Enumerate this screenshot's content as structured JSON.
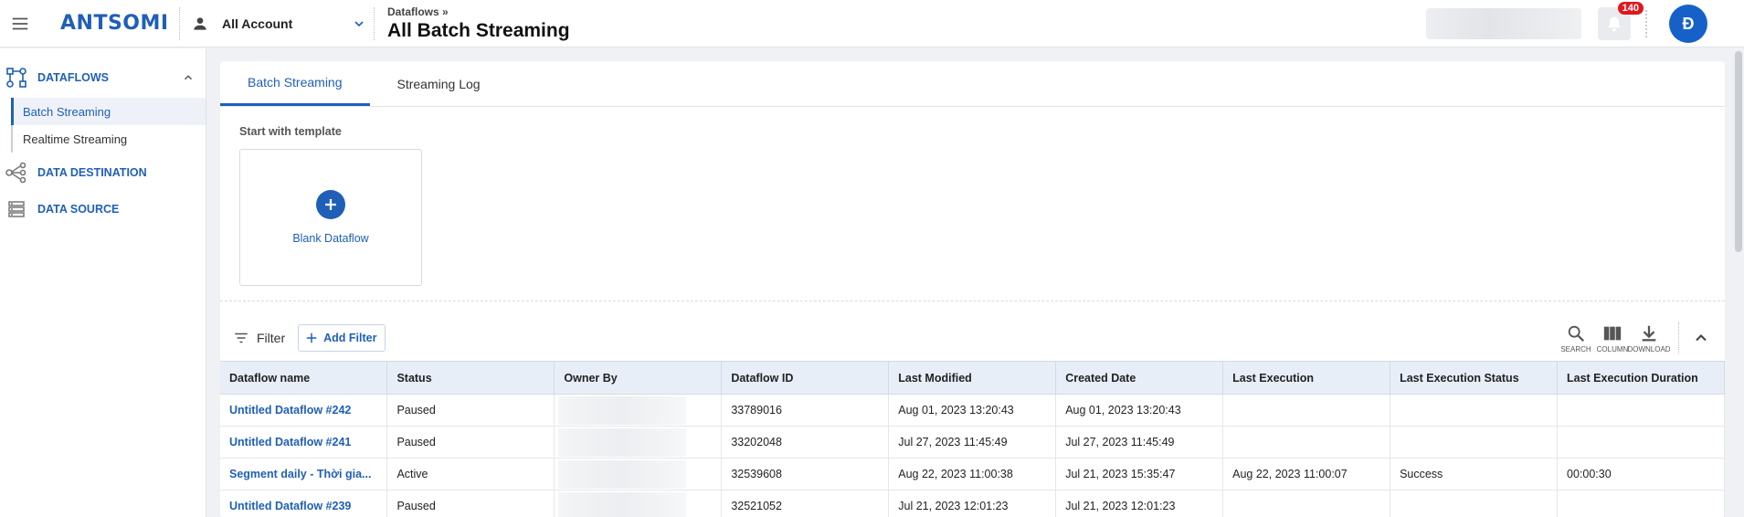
{
  "header": {
    "logo": "ANTSOMI",
    "account_label": "All Account",
    "breadcrumb": "Dataflows »",
    "title": "All Batch Streaming",
    "notification_count": "140",
    "avatar_letter": "Đ"
  },
  "sidebar": {
    "groups": [
      {
        "label": "DATAFLOWS",
        "icon": "dataflow-icon"
      },
      {
        "label": "DATA DESTINATION",
        "icon": "share-nodes-icon"
      },
      {
        "label": "DATA SOURCE",
        "icon": "server-list-icon"
      }
    ],
    "dataflow_items": [
      "Batch Streaming",
      "Realtime Streaming"
    ]
  },
  "tabs": [
    "Batch Streaming",
    "Streaming Log"
  ],
  "template": {
    "title": "Start with template",
    "card_label": "Blank Dataflow"
  },
  "filter": {
    "label": "Filter",
    "add_label": "Add Filter"
  },
  "tools": {
    "search": "SEARCH",
    "column": "COLUMN",
    "download": "DOWNLOAD"
  },
  "table": {
    "headers": [
      "Dataflow name",
      "Status",
      "Owner By",
      "Dataflow ID",
      "Last Modified",
      "Created Date",
      "Last Execution",
      "Last Execution Status",
      "Last Execution Duration"
    ],
    "rows": [
      [
        "Untitled Dataflow #242",
        "Paused",
        "",
        "33789016",
        "Aug 01, 2023 13:20:43",
        "Aug 01, 2023 13:20:43",
        "",
        "",
        ""
      ],
      [
        "Untitled Dataflow #241",
        "Paused",
        "",
        "33202048",
        "Jul 27, 2023 11:45:49",
        "Jul 27, 2023 11:45:49",
        "",
        "",
        ""
      ],
      [
        "Segment daily - Thời gia...",
        "Active",
        "",
        "32539608",
        "Aug 22, 2023 11:00:38",
        "Jul 21, 2023 15:35:47",
        "Aug 22, 2023 11:00:07",
        "Success",
        "00:00:30"
      ],
      [
        "Untitled Dataflow #239",
        "Paused",
        "",
        "32521052",
        "Jul 21, 2023 12:01:23",
        "Jul 21, 2023 12:01:23",
        "",
        "",
        ""
      ]
    ]
  },
  "colors": {
    "brand": "#1f5fb8",
    "badge": "#e0171e",
    "avatar": "#1561c7"
  }
}
